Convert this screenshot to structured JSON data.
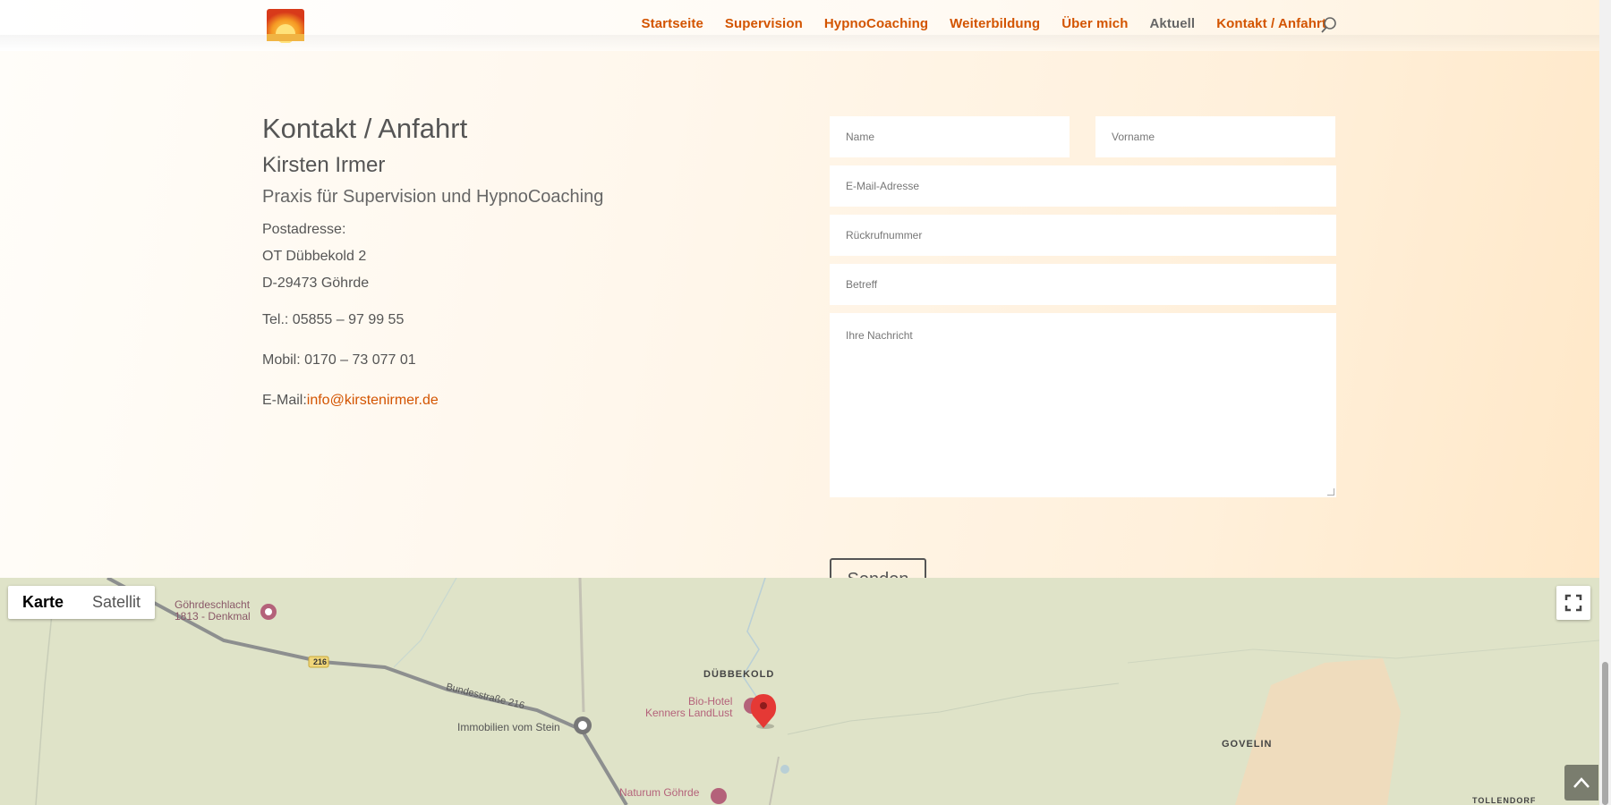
{
  "header": {
    "nav": [
      {
        "label": "Startseite"
      },
      {
        "label": "Supervision"
      },
      {
        "label": "HypnoCoaching"
      },
      {
        "label": "Weiterbildung"
      },
      {
        "label": "Über mich"
      },
      {
        "label": "Aktuell"
      },
      {
        "label": "Kontakt / Anfahrt"
      }
    ]
  },
  "contact": {
    "title": "Kontakt / Anfahrt",
    "name": "Kirsten Irmer",
    "tagline": "Praxis für Supervision und HypnoCoaching",
    "address_label": "Postadresse:",
    "street": "OT Dübbekold 2",
    "city": "D-29473 Göhrde",
    "phone": "Tel.: 05855 – 97 99 55",
    "mobile": "Mobil: 0170 – 73 077 01",
    "email_label": "E-Mail:",
    "email": "info@kirstenirmer.de"
  },
  "form": {
    "name_placeholder": "Name",
    "firstname_placeholder": "Vorname",
    "email_placeholder": "E-Mail-Adresse",
    "callback_placeholder": "Rückrufnummer",
    "subject_placeholder": "Betreff",
    "message_placeholder": "Ihre Nachricht",
    "submit_label": "Senden"
  },
  "map": {
    "type_map": "Karte",
    "type_satellite": "Satellit",
    "labels": {
      "denkmal": "Göhrdeschlacht\n1813 - Denkmal",
      "road_number": "216",
      "road_name": "Bundesstraße 216",
      "immobilien": "Immobilien vom Stein",
      "village": "DÜBBEKOLD",
      "hotel": "Bio-Hotel\nKenners LandLust",
      "museum": "Naturum Göhrde",
      "govelin": "GOVELIN",
      "tollendorf": "TOLLENDORF"
    }
  },
  "colors": {
    "accent": "#d35400",
    "text": "#555555",
    "map_bg": "#dfe3c8",
    "marker": "#e53935"
  }
}
